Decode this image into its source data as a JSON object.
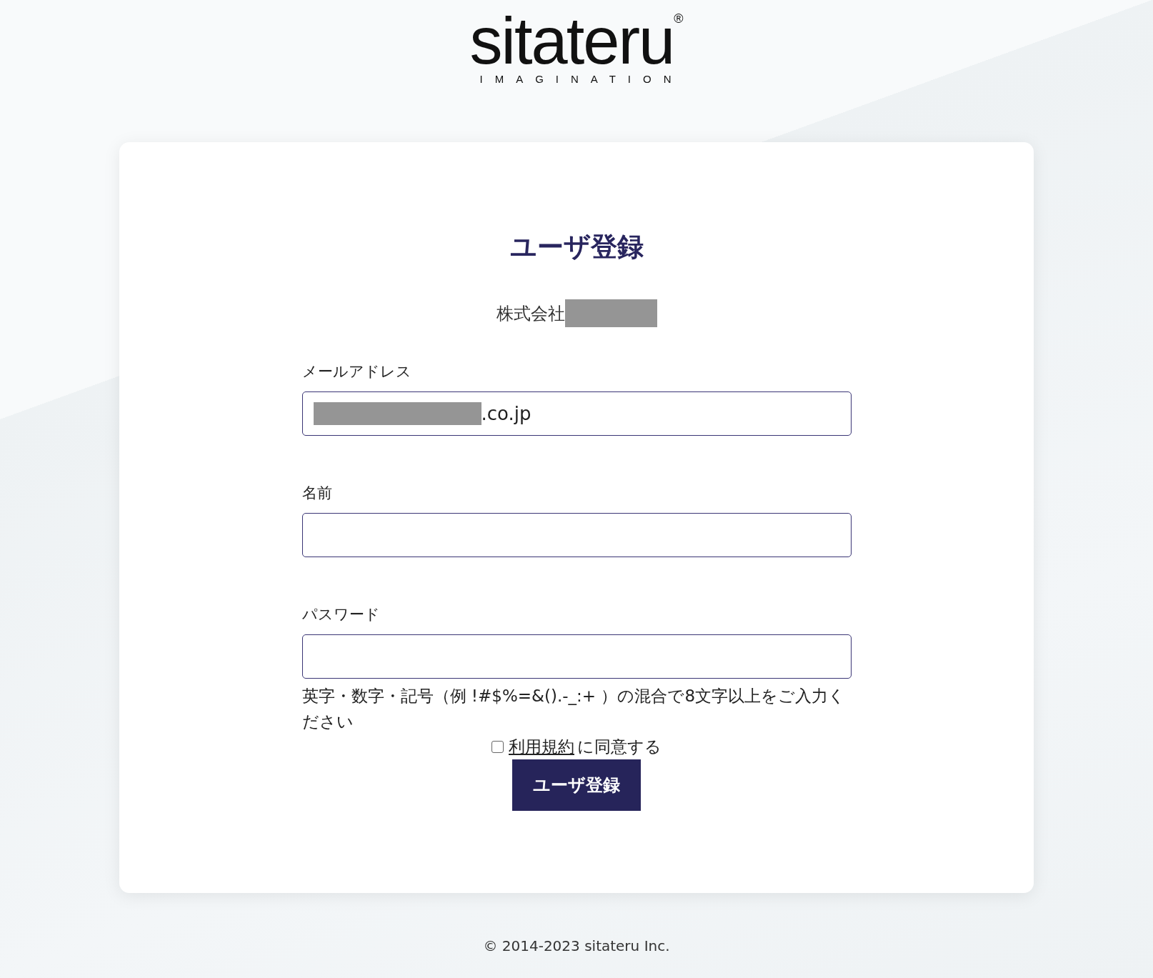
{
  "logo": {
    "wordmark": "sitateru",
    "registered": "®",
    "tagline": "IMAGINATION"
  },
  "title": "ユーザ登録",
  "company": {
    "name": "株式会社",
    "redacted": true
  },
  "fields": [
    {
      "label": "メールアドレス",
      "value": ".co.jp",
      "redacted": true
    },
    {
      "label": "名前",
      "redacted": false
    },
    {
      "label": "パスワード",
      "redacted": false
    }
  ],
  "password_hint": "英字・数字・記号（例 !#$%=&().-_:+ ）の混合で8文字以上をご入力ください",
  "agreement": {
    "checked": false,
    "link": "利用規約",
    "text": "に同意する"
  },
  "submit_button": "ユーザ登録",
  "footer": "© 2014-2023 sitateru Inc."
}
